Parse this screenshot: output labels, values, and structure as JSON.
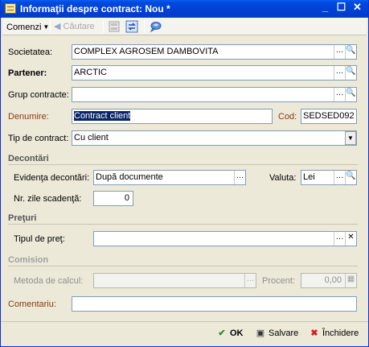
{
  "window": {
    "title": "Informaţii despre contract: Nou *"
  },
  "toolbar": {
    "menu_label": "Comenzi",
    "search_label": "Căutare"
  },
  "fields": {
    "societatea": {
      "label": "Societatea:",
      "value": "COMPLEX AGROSEM DAMBOVITA"
    },
    "partener": {
      "label": "Partener:",
      "value": "ARCTIC"
    },
    "grup": {
      "label": "Grup contracte:",
      "value": ""
    },
    "denumire": {
      "label": "Denumire:",
      "value": "Contract client"
    },
    "cod": {
      "label": "Cod:",
      "value": "SEDSED092"
    },
    "tip": {
      "label": "Tip de contract:",
      "value": "Cu client"
    }
  },
  "decontari": {
    "title": "Decontări",
    "evidenta": {
      "label": "Evidenţa decontări:",
      "value": "După documente"
    },
    "valuta": {
      "label": "Valuta:",
      "value": "Lei"
    },
    "zile": {
      "label": "Nr. zile scadenţă:",
      "value": "0"
    }
  },
  "preturi": {
    "title": "Preţuri",
    "tip_pret": {
      "label": "Tipul de preţ:",
      "value": ""
    }
  },
  "comision": {
    "title": "Comision",
    "metoda": {
      "label": "Metoda de calcul:",
      "value": ""
    },
    "procent": {
      "label": "Procent:",
      "value": "0,00"
    }
  },
  "comentariu": {
    "label": "Comentariu:",
    "value": ""
  },
  "footer": {
    "ok": "OK",
    "save": "Salvare",
    "close": "Închidere"
  },
  "colors": {
    "title_bar": "#0042d6",
    "accent_label": "#8b3a0f",
    "selection": "#0a246a"
  }
}
